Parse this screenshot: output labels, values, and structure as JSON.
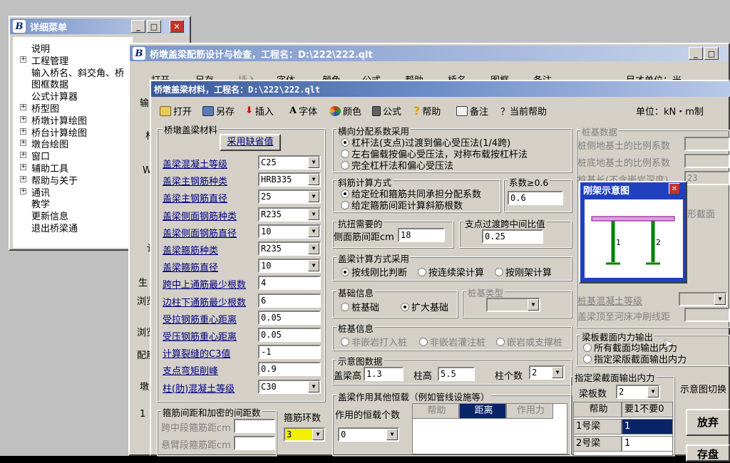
{
  "detail_menu": {
    "title": "详细菜单",
    "items": [
      "说明",
      "工程管理",
      "输入桥名、斜交角、桥",
      "图框数据",
      "公式计算器",
      "桥型图",
      "桥墩计算绘图",
      "桥台计算绘图",
      "墩台绘图",
      "窗口",
      "辅助工具",
      "帮助与关于",
      "通讯",
      "教学",
      "更新信息",
      "退出桥梁通"
    ]
  },
  "main_window": {
    "title": "桥墩盖梁配筋设计与检查，工程名：D:\\222\\222.qlt",
    "toolbar": [
      "打开",
      "另存",
      "插入",
      "字体",
      "颜色",
      "公式",
      "帮助",
      "桥名",
      "图框",
      "备注"
    ],
    "unit_partial": "目才单位：米",
    "left_fragments": [
      "输",
      "材",
      "W",
      "计算",
      "生",
      "浏览",
      "浏览",
      "配筋",
      "墩",
      "1"
    ]
  },
  "material_window": {
    "title": "桥墩盖梁材料，工程名：D:\\222\\222.qlt",
    "toolbar": {
      "open": "打开",
      "save_as": "另存",
      "insert": "插入",
      "font": "字体",
      "color": "颜色",
      "formula": "公式",
      "help": "帮助",
      "notes": "备注",
      "current_help": "？当前帮助",
      "units": "单位：kN・m制"
    },
    "materials": {
      "group_title": "桥墩盖梁材料",
      "default_button": "采用缺省值",
      "rows": [
        {
          "label": "盖梁混凝土等级",
          "value": "C25"
        },
        {
          "label": "盖梁主钢筋种类",
          "value": "HRB335"
        },
        {
          "label": "盖梁主钢筋直径",
          "value": "25"
        },
        {
          "label": "盖梁侧面钢筋种类",
          "value": "R235"
        },
        {
          "label": "盖梁侧面钢筋直径",
          "value": "10"
        },
        {
          "label": "盖梁箍筋种类",
          "value": "R235"
        },
        {
          "label": "盖梁箍筋直径",
          "value": "10"
        },
        {
          "label": "跨中上通筋最少根数",
          "value": "4"
        },
        {
          "label": "边柱下通筋最少根数",
          "value": "6"
        },
        {
          "label": "受拉钢筋重心距离",
          "value": "0.05"
        },
        {
          "label": "受压钢筋重心距离",
          "value": "0.05"
        },
        {
          "label": "计算裂缝的C3值",
          "value": "-1"
        },
        {
          "label": "支点弯矩削峰",
          "value": "0.9"
        },
        {
          "label": "柱(肋)混凝土等级",
          "value": "C30"
        }
      ]
    },
    "stirrup": {
      "group_title": "箍筋间距和加密的间距数",
      "mid": "跨中段箍筋距cm",
      "cant": "悬臂段箍筋距cm",
      "rings_label": "箍筋环数",
      "rings_value": "3"
    },
    "lateral": {
      "group_title": "横向分配系数采用",
      "options": [
        "杠杆法(支点)过渡到偏心受压法(1/4跨)",
        "左右偏载按偏心受压法，对称布载按杠杆法",
        "完全杠杆法和偏心受压法"
      ]
    },
    "shear": {
      "group_title": "斜筋计算方式",
      "options": [
        "给定砼和箍筋共同承担分配系数",
        "给定箍筋间距计算斜筋根数"
      ],
      "coef_title": "系数≥0.6",
      "coef_value": "0.6"
    },
    "torsion": {
      "group_title": "抗扭需要的",
      "label": "侧面筋间距cm",
      "value": "18"
    },
    "ratio": {
      "group_title": "支点过渡跨中间比值",
      "value": "0.25"
    },
    "calc_method": {
      "group_title": "盖梁计算方式采用",
      "options": [
        "按线刚比判断",
        "按连续梁计算",
        "按刚架计算"
      ]
    },
    "foundation": {
      "group_title": "基础信息",
      "options": [
        "桩基础",
        "扩大基础"
      ],
      "pile_type_title": "桩基类型"
    },
    "pile_info": {
      "group_title": "桩基信息",
      "options": [
        "非嵌岩打入桩",
        "非嵌岩灌注桩",
        "嵌岩或支撑桩"
      ]
    },
    "diagram_data": {
      "group_title": "示意图数据",
      "beam_h_label": "盖梁高",
      "beam_h": "1.3",
      "col_h_label": "柱高",
      "col_h": "5.5",
      "col_n_label": "柱个数",
      "col_n": "2"
    },
    "other_loads": {
      "group_title": "盖梁作用其他恒载（例如管线设施等）",
      "count_label": "作用的恒载个数",
      "count": "0",
      "cols": [
        "帮助",
        "距离",
        "作用力"
      ]
    },
    "pile_data": {
      "group_title": "桩基数据",
      "rows": [
        "桩侧地基土的比例系数",
        "桩底地基土的比例系数",
        "桩基长(不含嵌岩深度)",
        "桩基混凝土等级",
        "盖梁顶至河床冲刷线距"
      ],
      "value3": "23",
      "partial": "形截面"
    },
    "frame_popup": {
      "title": "刚架示意图",
      "col1": "1",
      "col2": "2"
    },
    "beam_output": {
      "group_title": "梁板截面内力输出",
      "options": [
        "所有截面均输出内力",
        "指定梁版截面输出内力"
      ]
    },
    "spec_output": {
      "group_title": "指定梁截面输出内力",
      "count_label": "梁板数",
      "count": "2",
      "cols": [
        "帮助",
        "要1不要0"
      ],
      "rows": [
        {
          "name": "1号梁",
          "val": "1"
        },
        {
          "name": "2号梁",
          "val": "1"
        }
      ]
    },
    "right_panel": {
      "diagram_switch": "示意图切换",
      "discard": "放弃",
      "save": "存盘"
    }
  },
  "colors": {
    "title_active": "#0a246a",
    "title_inactive": "#7a96c8",
    "face": "#d4d0c8",
    "link": "#000080",
    "selected": "#0a246a"
  }
}
